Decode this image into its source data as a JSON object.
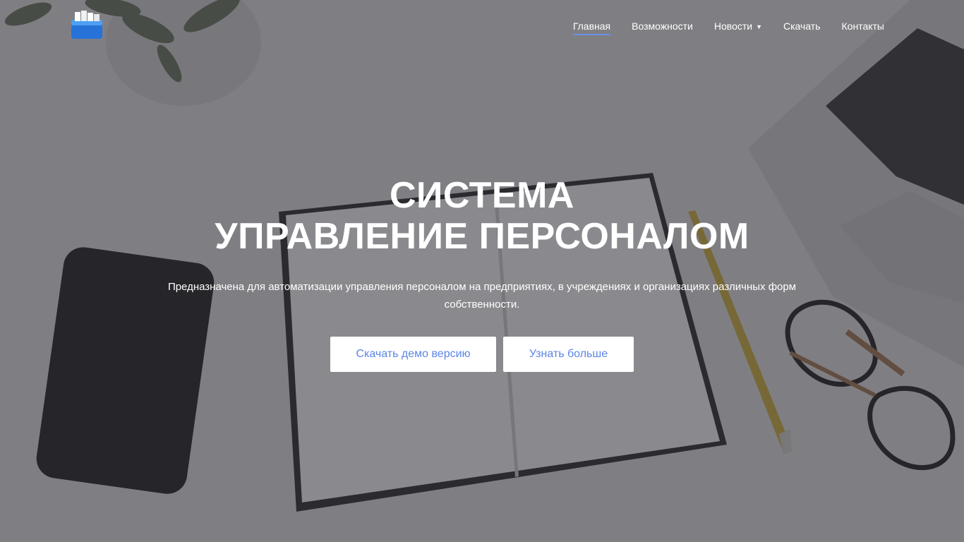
{
  "nav": {
    "items": [
      {
        "label": "Главная",
        "active": true
      },
      {
        "label": "Возможности"
      },
      {
        "label": "Новости",
        "has_dropdown": true
      },
      {
        "label": "Скачать"
      },
      {
        "label": "Контакты"
      }
    ]
  },
  "hero": {
    "title_line1": "СИСТЕМА",
    "title_line2": "УПРАВЛЕНИЕ ПЕРСОНАЛОМ",
    "subtitle": "Предназначена для автоматизации управления персоналом на предприятиях, в учреждениях и организациях различных форм собственности.",
    "primary_button": "Скачать демо версию",
    "secondary_button": "Узнать больше"
  },
  "colors": {
    "accent": "#5b86e5",
    "active_underline": "#6a8fe8",
    "overlay": "#34343a",
    "logo_blue": "#2f7be0"
  },
  "icons": {
    "logo": "folder-cabinet-icon",
    "dropdown": "chevron-down-icon"
  }
}
